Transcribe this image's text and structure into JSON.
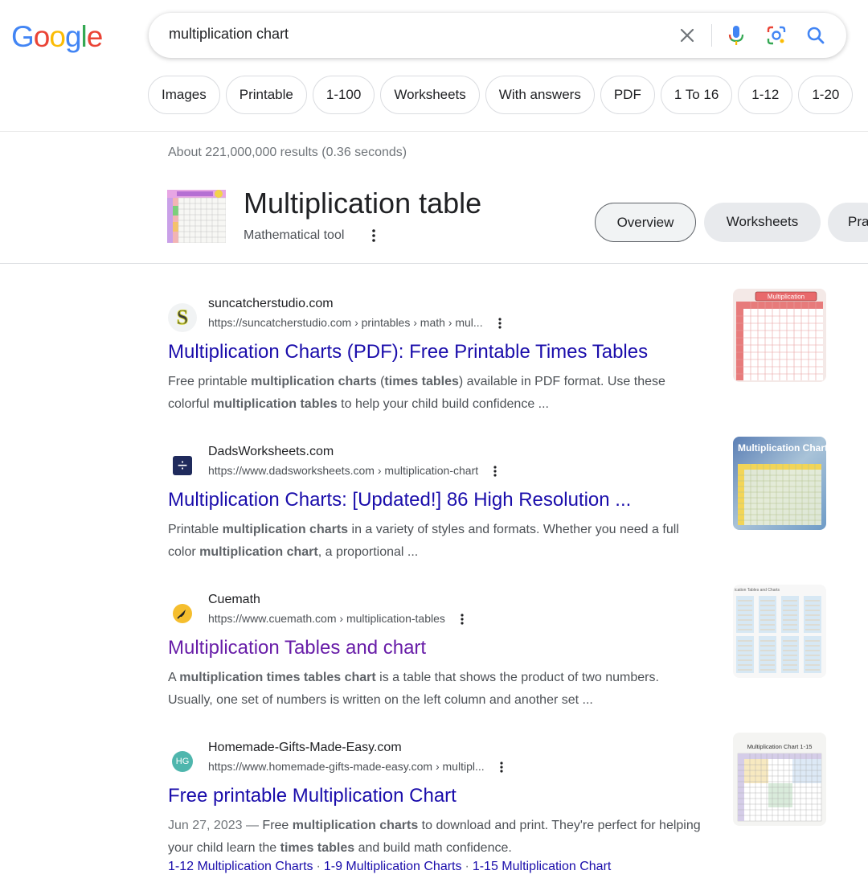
{
  "logo": {
    "letters": [
      "G",
      "o",
      "o",
      "g",
      "l",
      "e"
    ],
    "colors": [
      "#4285f4",
      "#ea4335",
      "#fbbc05",
      "#4285f4",
      "#34a853",
      "#ea4335"
    ]
  },
  "search": {
    "query": "multiplication chart"
  },
  "chips": [
    "Images",
    "Printable",
    "1-100",
    "Worksheets",
    "With answers",
    "PDF",
    "1 To 16",
    "1-12",
    "1-20"
  ],
  "stats": "About 221,000,000 results (0.36 seconds)",
  "knowledge": {
    "title": "Multiplication table",
    "subtitle": "Mathematical tool",
    "tabs": [
      "Overview",
      "Worksheets",
      "Pra"
    ]
  },
  "results": [
    {
      "site": "suncatcherstudio.com",
      "url": "https://suncatcherstudio.com › printables › math › mul...",
      "title": "Multiplication Charts (PDF): Free Printable Times Tables",
      "favicon_letter": "S",
      "snippet": [
        {
          "t": "Free printable ",
          "b": false
        },
        {
          "t": "multiplication charts",
          "b": true
        },
        {
          "t": " (",
          "b": false
        },
        {
          "t": "times tables",
          "b": true
        },
        {
          "t": ") available in PDF format. Use these colorful ",
          "b": false
        },
        {
          "t": "multiplication tables",
          "b": true
        },
        {
          "t": " to help your child build confidence ...",
          "b": false
        }
      ],
      "thumb_label": "Multiplication"
    },
    {
      "site": "DadsWorksheets.com",
      "url": "https://www.dadsworksheets.com › multiplication-chart",
      "title": "Multiplication Charts: [Updated!] 86 High Resolution ...",
      "favicon_letter": "÷",
      "snippet": [
        {
          "t": "Printable ",
          "b": false
        },
        {
          "t": "multiplication charts",
          "b": true
        },
        {
          "t": " in a variety of styles and formats. Whether you need a full color ",
          "b": false
        },
        {
          "t": "multiplication chart",
          "b": true
        },
        {
          "t": ", a proportional ...",
          "b": false
        }
      ],
      "thumb_label": "Multiplication Chart"
    },
    {
      "site": "Cuemath",
      "url": "https://www.cuemath.com › multiplication-tables",
      "title": "Multiplication Tables and chart",
      "favicon_letter": "",
      "snippet": [
        {
          "t": "A ",
          "b": false
        },
        {
          "t": "multiplication times tables chart",
          "b": true
        },
        {
          "t": " is a table that shows the product of two numbers. Usually, one set of numbers is written on the left column and another set ...",
          "b": false
        }
      ],
      "thumb_label": "ication Tables and Charts"
    },
    {
      "site": "Homemade-Gifts-Made-Easy.com",
      "url": "https://www.homemade-gifts-made-easy.com › multipl...",
      "title": "Free printable Multiplication Chart",
      "favicon_letter": "HG",
      "snippet": [
        {
          "t": "Jun 27, 2023 — ",
          "b": false,
          "date": true
        },
        {
          "t": "Free ",
          "b": false
        },
        {
          "t": "multiplication charts",
          "b": true
        },
        {
          "t": " to download and print. They're perfect for helping your child learn the ",
          "b": false
        },
        {
          "t": "times tables",
          "b": true
        },
        {
          "t": " and build math confidence.",
          "b": false
        }
      ],
      "sitelinks": [
        "1-12 Multiplication Charts",
        "1-9 Multiplication Charts",
        "1-15 Multiplication Chart"
      ],
      "thumb_label": "Multiplication Chart 1-15"
    }
  ]
}
